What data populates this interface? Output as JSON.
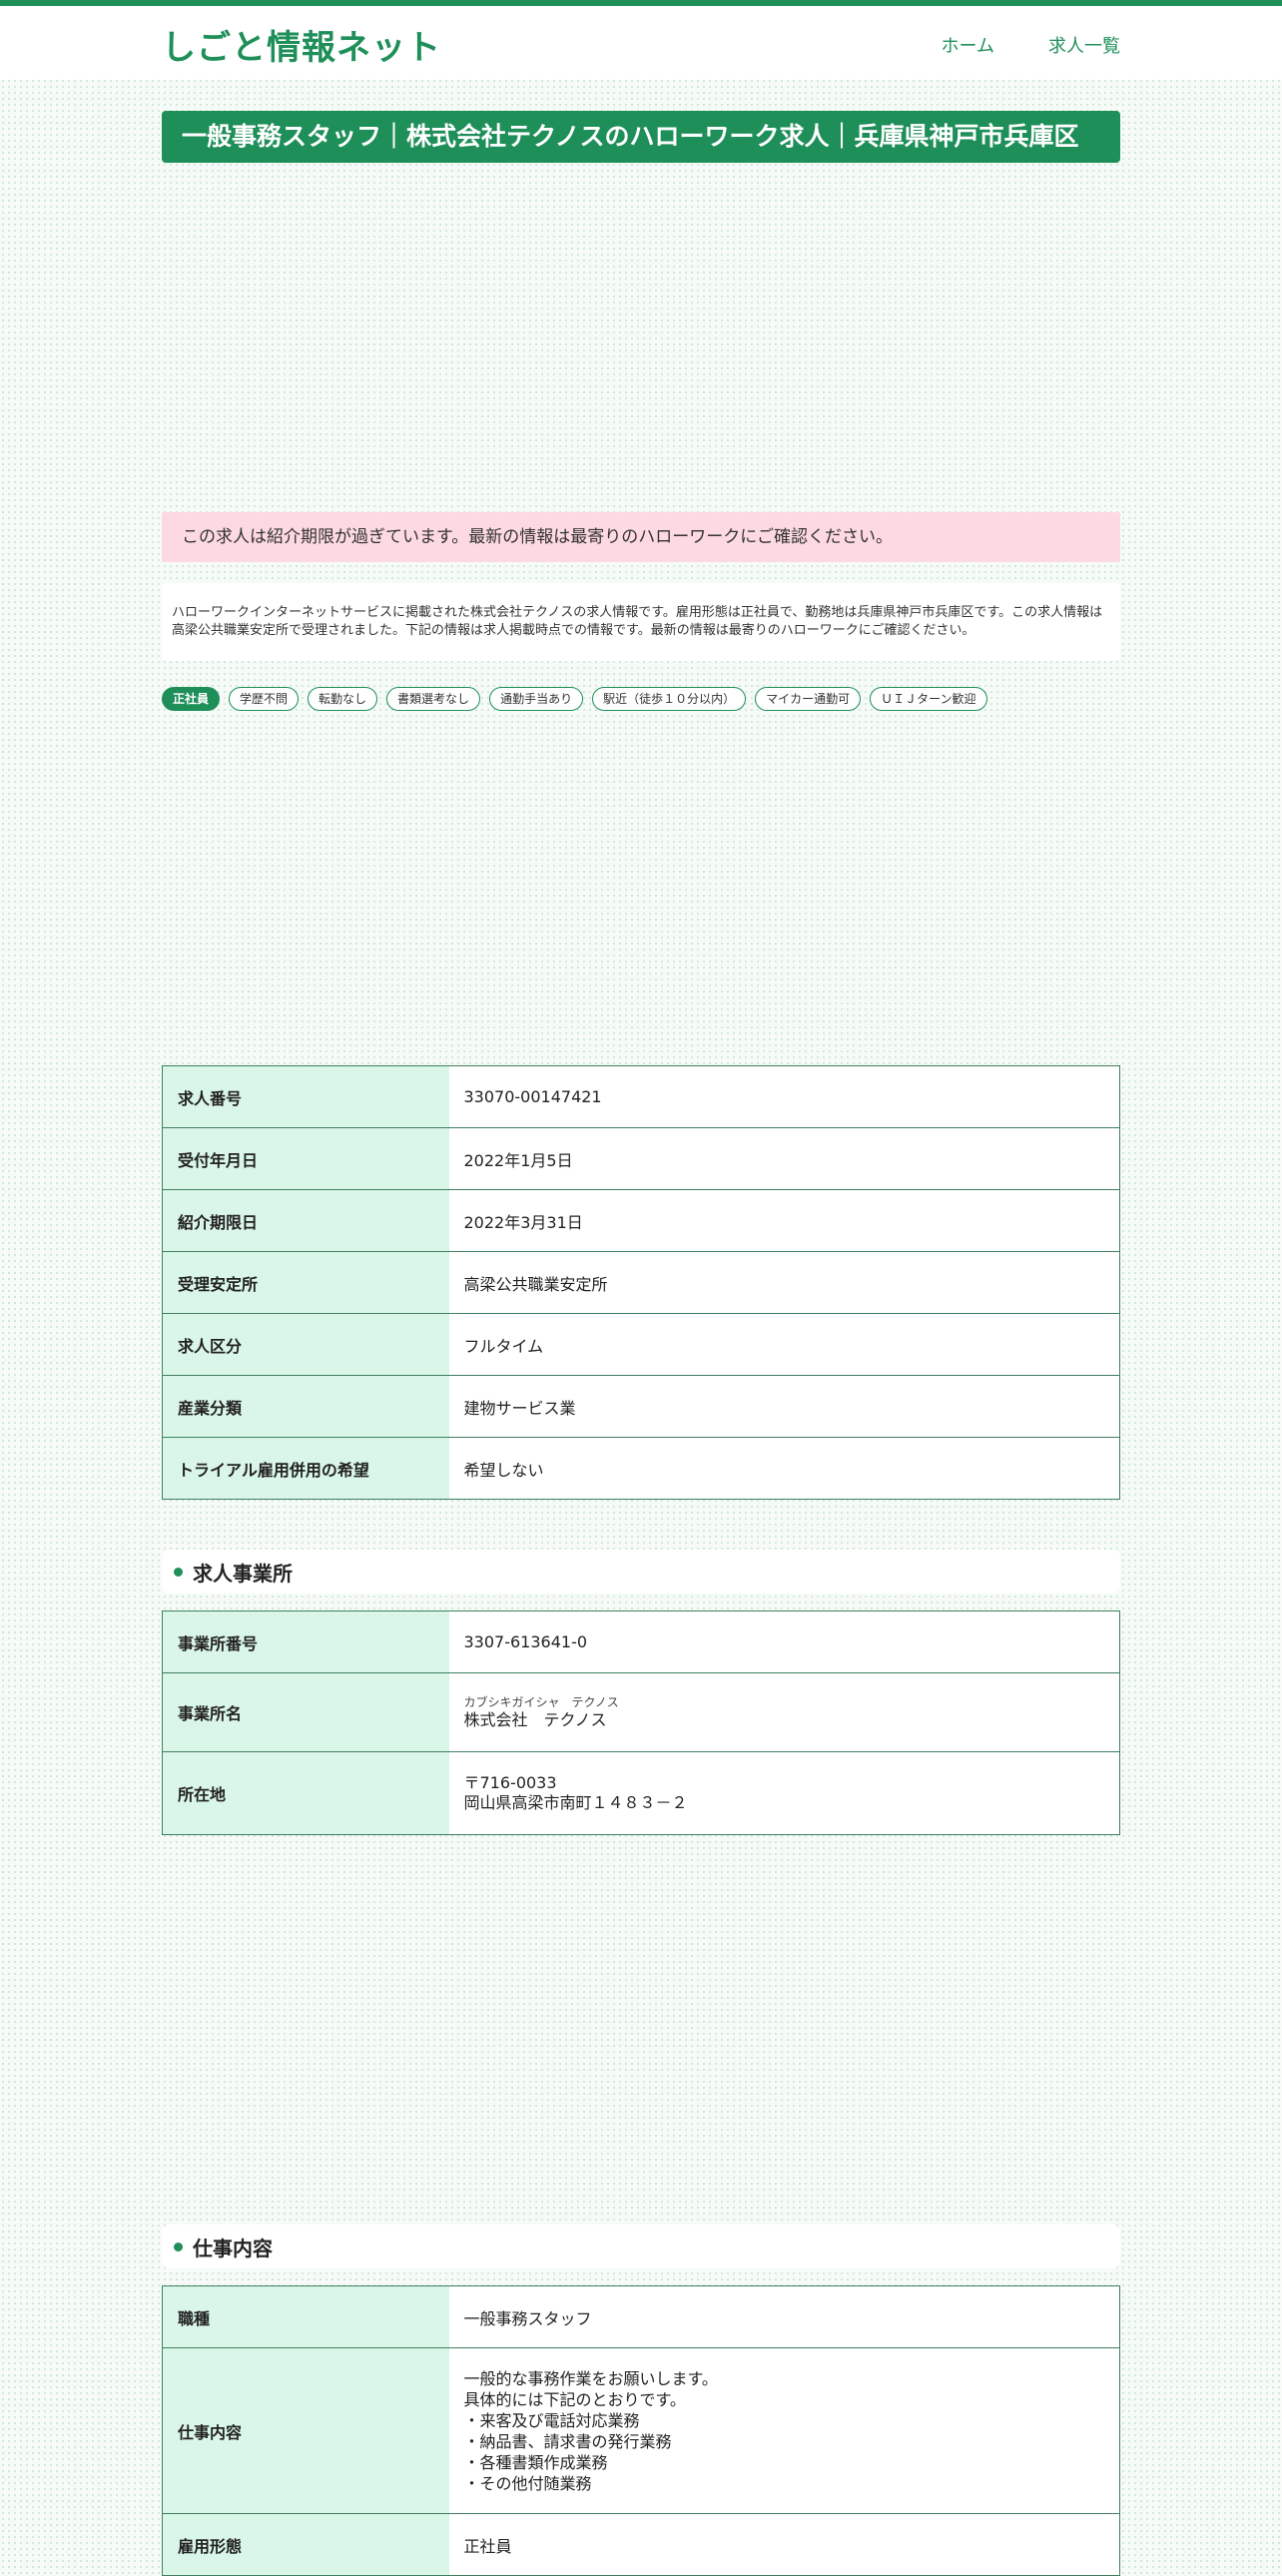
{
  "site": {
    "logo": "しごと情報ネット",
    "nav": [
      "ホーム",
      "求人一覧"
    ]
  },
  "page_title": "一般事務スタッフ｜株式会社テクノスのハローワーク求人｜兵庫県神戸市兵庫区",
  "notice": "この求人は紹介期限が過ぎています。最新の情報は最寄りのハローワークにご確認ください。",
  "intro": "ハローワークインターネットサービスに掲載された株式会社テクノスの求人情報です。雇用形態は正社員で、勤務地は兵庫県神戸市兵庫区です。この求人情報は高梁公共職業安定所で受理されました。下記の情報は求人掲載時点での情報です。最新の情報は最寄りのハローワークにご確認ください。",
  "tags": [
    "正社員",
    "学歴不問",
    "転勤なし",
    "書類選考なし",
    "通勤手当あり",
    "駅近（徒歩１０分以内）",
    "マイカー通勤可",
    "ＵＩＪターン歓迎"
  ],
  "summary_table": [
    {
      "label": "求人番号",
      "value": "33070-00147421"
    },
    {
      "label": "受付年月日",
      "value": "2022年1月5日"
    },
    {
      "label": "紹介期限日",
      "value": "2022年3月31日"
    },
    {
      "label": "受理安定所",
      "value": "高梁公共職業安定所"
    },
    {
      "label": "求人区分",
      "value": "フルタイム"
    },
    {
      "label": "産業分類",
      "value": "建物サービス業"
    },
    {
      "label": "トライアル雇用併用の希望",
      "value": "希望しない"
    }
  ],
  "employer_section": {
    "heading": "求人事業所",
    "office_no_label": "事業所番号",
    "office_no": "3307-613641-0",
    "name_label": "事業所名",
    "name_kana": "カブシキガイシャ　テクノス",
    "name": "株式会社　テクノス",
    "address_label": "所在地",
    "postal": "〒716-0033",
    "address": "岡山県高梁市南町１４８３－２"
  },
  "job_section": {
    "heading": "仕事内容",
    "occupation_label": "職種",
    "occupation": "一般事務スタッフ",
    "content_label": "仕事内容",
    "content_lines": [
      "一般的な事務作業をお願いします。",
      "具体的には下記のとおりです。",
      "・来客及び電話対応業務",
      "・納品書、請求書の発行業務",
      "・各種書類作成業務",
      "・その他付随業務"
    ],
    "employment_label": "雇用形態",
    "employment": "正社員"
  }
}
